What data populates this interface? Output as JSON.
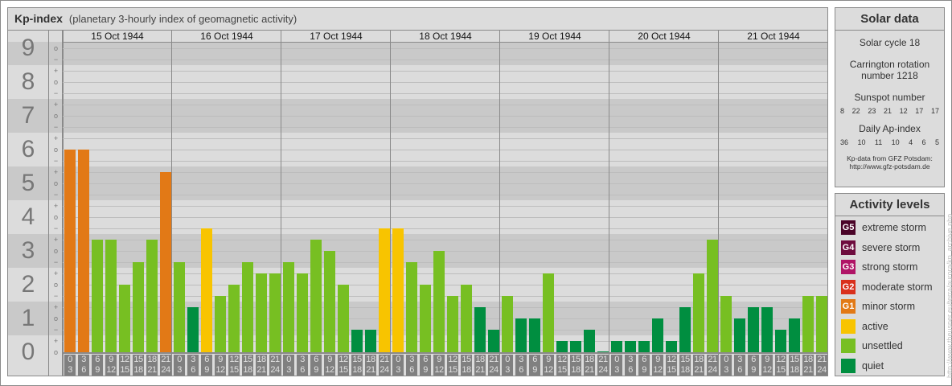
{
  "header": {
    "title": "Kp-index",
    "subtitle": "(planetary 3-hourly index of geomagnetic activity)"
  },
  "chart_data": {
    "type": "bar",
    "ylim": [
      0,
      9
    ],
    "y_ticks": [
      "0",
      "1",
      "2",
      "3",
      "4",
      "5",
      "6",
      "7",
      "8",
      "9"
    ],
    "sub_ticks": [
      "o",
      "+",
      "−",
      "o",
      "+",
      "−",
      "o",
      "+",
      "−",
      "o",
      "+",
      "−",
      "o",
      "+",
      "−",
      "o",
      "+",
      "−",
      "o",
      "+",
      "−",
      "o",
      "+",
      "−",
      "o",
      "+",
      "−",
      "o"
    ],
    "days": [
      "15 Oct 1944",
      "16 Oct 1944",
      "17 Oct 1944",
      "18 Oct 1944",
      "19 Oct 1944",
      "20 Oct 1944",
      "21 Oct 1944"
    ],
    "intervals": [
      [
        "0",
        "3"
      ],
      [
        "3",
        "6"
      ],
      [
        "6",
        "9"
      ],
      [
        "9",
        "12"
      ],
      [
        "12",
        "15"
      ],
      [
        "15",
        "18"
      ],
      [
        "18",
        "21"
      ],
      [
        "21",
        "24"
      ]
    ],
    "values": [
      [
        "6o",
        "6o",
        "3+",
        "3+",
        "2o",
        "3-",
        "3+",
        "5+"
      ],
      [
        "3-",
        "1+",
        "4-",
        "2-",
        "2o",
        "3-",
        "2+",
        "2+"
      ],
      [
        "3-",
        "2+",
        "3+",
        "3o",
        "2o",
        "1-",
        "1-",
        "4-"
      ],
      [
        "4-",
        "3-",
        "2o",
        "3o",
        "2-",
        "2o",
        "1+",
        "1-"
      ],
      [
        "2-",
        "1o",
        "1o",
        "2+",
        "0+",
        "0+",
        "1-",
        "0o"
      ],
      [
        "0+",
        "0+",
        "0+",
        "1o",
        "0+",
        "1+",
        "2+",
        "3+"
      ],
      [
        "2-",
        "1o",
        "1+",
        "1+",
        "1-",
        "1o",
        "2-",
        "2-"
      ]
    ]
  },
  "colors": {
    "quiet": "#008e40",
    "unsettled": "#77bf22",
    "active": "#f8c400",
    "G1": "#e27916",
    "G2": "#d9301c",
    "G3": "#b01466",
    "G4": "#6e0c3e",
    "G5": "#4b0428"
  },
  "solar": {
    "title": "Solar data",
    "cycle": "Solar cycle 18",
    "carrington_1": "Carrington rotation",
    "carrington_2": "number 1218",
    "sunspot_label": "Sunspot number",
    "sunspots": [
      "8",
      "22",
      "23",
      "21",
      "12",
      "17",
      "17"
    ],
    "ap_label": "Daily Ap-index",
    "ap": [
      "36",
      "10",
      "11",
      "10",
      "4",
      "6",
      "5"
    ],
    "source_1": "Kp-data from GFZ Potsdam:",
    "source_2": "http://www.gfz-potsdam.de"
  },
  "legend": {
    "title": "Activity levels",
    "items": [
      {
        "code": "G5",
        "label": "extreme storm",
        "color": "#4b0428"
      },
      {
        "code": "G4",
        "label": "severe storm",
        "color": "#6e0c3e"
      },
      {
        "code": "G3",
        "label": "strong storm",
        "color": "#b01466"
      },
      {
        "code": "G2",
        "label": "moderate storm",
        "color": "#d9301c"
      },
      {
        "code": "G1",
        "label": "minor storm",
        "color": "#e27916"
      },
      {
        "code": "",
        "label": "active",
        "color": "#f8c400"
      },
      {
        "code": "",
        "label": "unsettled",
        "color": "#77bf22"
      },
      {
        "code": "",
        "label": "quiet",
        "color": "#008e40"
      }
    ]
  },
  "watermark": "http://www.theusner.eu/terra/aurora/kp_archive.php"
}
